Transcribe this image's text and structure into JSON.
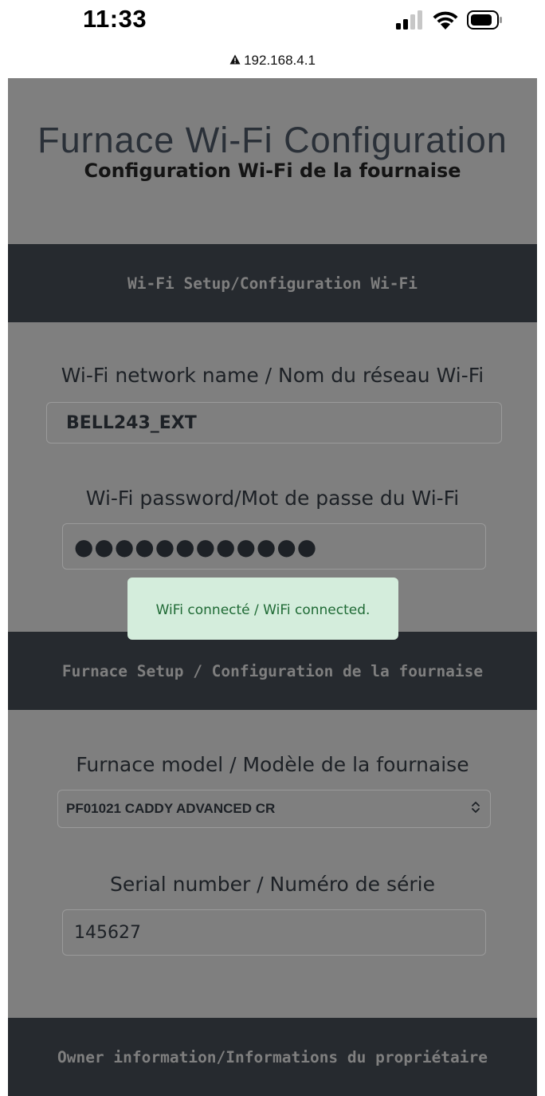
{
  "status_bar": {
    "time": "11:33",
    "icons": [
      "cellular-signal-icon",
      "wifi-icon",
      "battery-icon"
    ]
  },
  "browser": {
    "url": "192.168.4.1",
    "security_icon": "warning-icon"
  },
  "header": {
    "title": "Furnace Wi-Fi Configuration",
    "subtitle": "Configuration Wi-Fi de la fournaise"
  },
  "sections": {
    "wifi_setup": "Wi-Fi Setup/Configuration Wi-Fi",
    "furnace_setup": "Furnace Setup / Configuration de la fournaise",
    "owner_info": "Owner information/Informations du propriétaire"
  },
  "wifi": {
    "ssid_label": "Wi-Fi network name / Nom du réseau Wi-Fi",
    "ssid_value": "BELL243_EXT",
    "password_label": "Wi-Fi password/Mot de passe du Wi-Fi",
    "password_value": "●●●●●●●●●●●●"
  },
  "furnace": {
    "model_label": "Furnace model / Modèle de la fournaise",
    "model_value": "PF01021 CADDY ADVANCED CR",
    "serial_label": "Serial number / Numéro de série",
    "serial_value": "145627"
  },
  "toast": {
    "message": "WiFi connecté / WiFi connected."
  },
  "colors": {
    "page_background": "#7f7f7f",
    "band_background": "#262a2f",
    "toast_background": "#d4eddc",
    "toast_text": "#1f6a35"
  }
}
